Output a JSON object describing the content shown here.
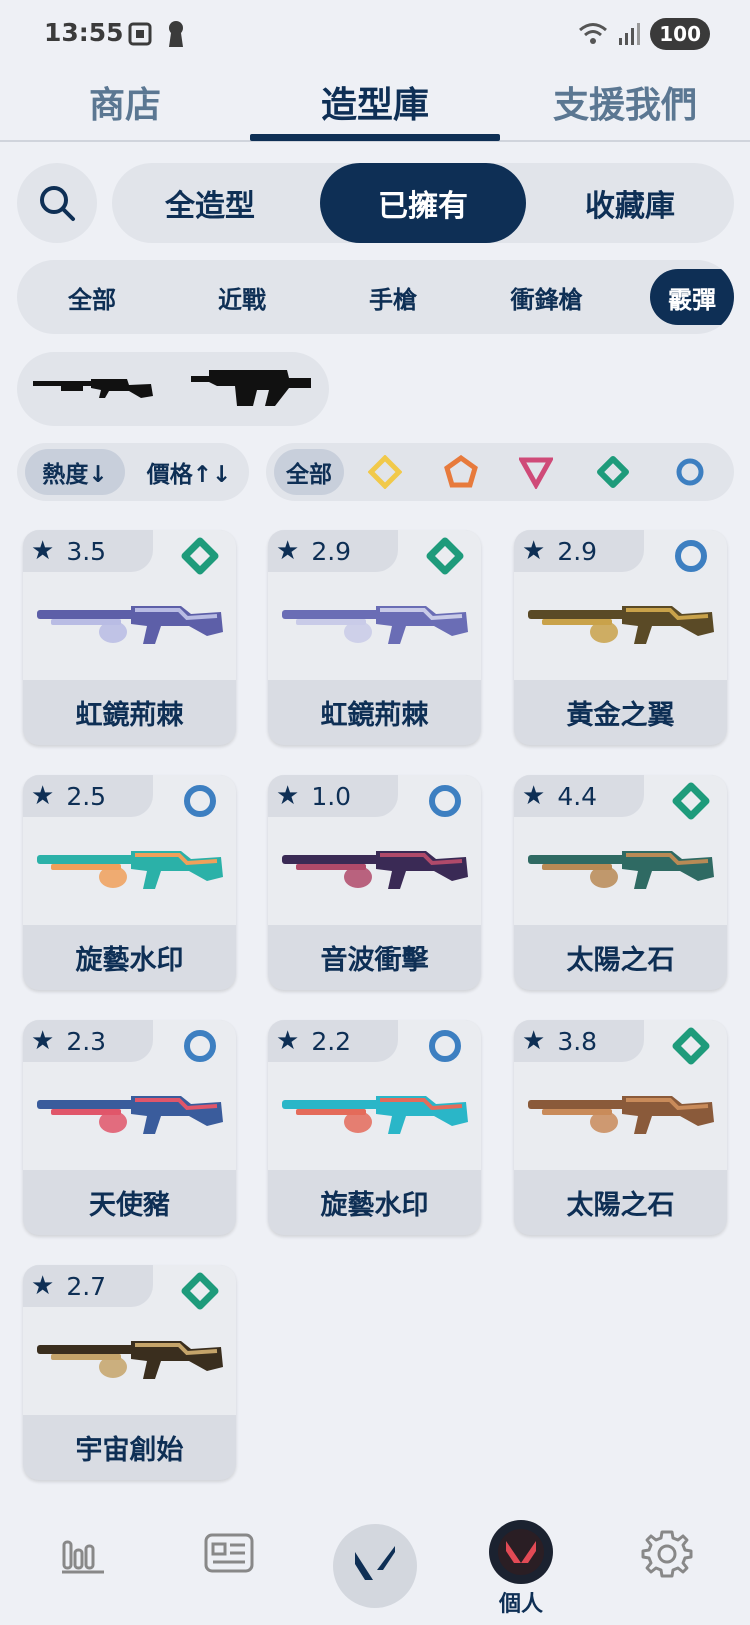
{
  "status_bar": {
    "time": "13:55",
    "battery": "100",
    "icons": [
      "screenshot-icon",
      "keyhole-icon",
      "wifi-icon",
      "signal-icon"
    ]
  },
  "top_tabs": [
    {
      "label": "商店",
      "active": false
    },
    {
      "label": "造型庫",
      "active": true
    },
    {
      "label": "支援我們",
      "active": false
    }
  ],
  "segments": [
    {
      "label": "全造型",
      "active": false
    },
    {
      "label": "已擁有",
      "active": true
    },
    {
      "label": "收藏庫",
      "active": false
    }
  ],
  "categories": [
    {
      "label": "全部",
      "active": false
    },
    {
      "label": "近戰",
      "active": false
    },
    {
      "label": "手槍",
      "active": false
    },
    {
      "label": "衝鋒槍",
      "active": false
    },
    {
      "label": "霰彈",
      "active": true
    }
  ],
  "gun_types": [
    "bucky-silhouette-icon",
    "judge-silhouette-icon"
  ],
  "sort": [
    {
      "label": "熱度↓",
      "active": true
    },
    {
      "label": "價格↑↓",
      "active": false
    }
  ],
  "tiers": {
    "all_label": "全部",
    "icons": [
      "ultra-tier-icon",
      "exclusive-tier-icon",
      "premium-tier-icon",
      "deluxe-tier-icon",
      "select-tier-icon"
    ],
    "colors": {
      "ultra": "#f1c94a",
      "exclusive": "#e77a3c",
      "premium": "#cf4a78",
      "deluxe": "#1e9b7b",
      "select": "#3d7fc1"
    }
  },
  "skins": [
    {
      "rating": "3.5",
      "tier": "deluxe",
      "name": "虹鏡荊棘",
      "colors": [
        "#5d5fa8",
        "#b9bce4"
      ]
    },
    {
      "rating": "2.9",
      "tier": "deluxe",
      "name": "虹鏡荊棘",
      "colors": [
        "#6a6db5",
        "#c9cbe8"
      ]
    },
    {
      "rating": "2.9",
      "tier": "select",
      "name": "黃金之翼",
      "colors": [
        "#5a4a26",
        "#c9a24a"
      ]
    },
    {
      "rating": "2.5",
      "tier": "select",
      "name": "旋藝水印",
      "colors": [
        "#2bb1a8",
        "#f0a05a"
      ]
    },
    {
      "rating": "1.0",
      "tier": "select",
      "name": "音波衝擊",
      "colors": [
        "#3a2a55",
        "#b04a6a"
      ]
    },
    {
      "rating": "4.4",
      "tier": "deluxe",
      "name": "太陽之石",
      "colors": [
        "#2f6a63",
        "#b98a55"
      ]
    },
    {
      "rating": "2.3",
      "tier": "select",
      "name": "天使豬",
      "colors": [
        "#3a5c9c",
        "#e0566a"
      ]
    },
    {
      "rating": "2.2",
      "tier": "select",
      "name": "旋藝水印",
      "colors": [
        "#2ab6c8",
        "#e46b5a"
      ]
    },
    {
      "rating": "3.8",
      "tier": "deluxe",
      "name": "太陽之石",
      "colors": [
        "#8a5a3a",
        "#c98b5a"
      ]
    },
    {
      "rating": "2.7",
      "tier": "deluxe",
      "name": "宇宙創始",
      "colors": [
        "#3a2e1e",
        "#c5a46a"
      ]
    }
  ],
  "bottom_nav": {
    "items": [
      "stats-icon",
      "news-icon",
      "home-logo-icon",
      "profile-avatar-icon",
      "settings-icon"
    ],
    "profile_label": "個人"
  }
}
